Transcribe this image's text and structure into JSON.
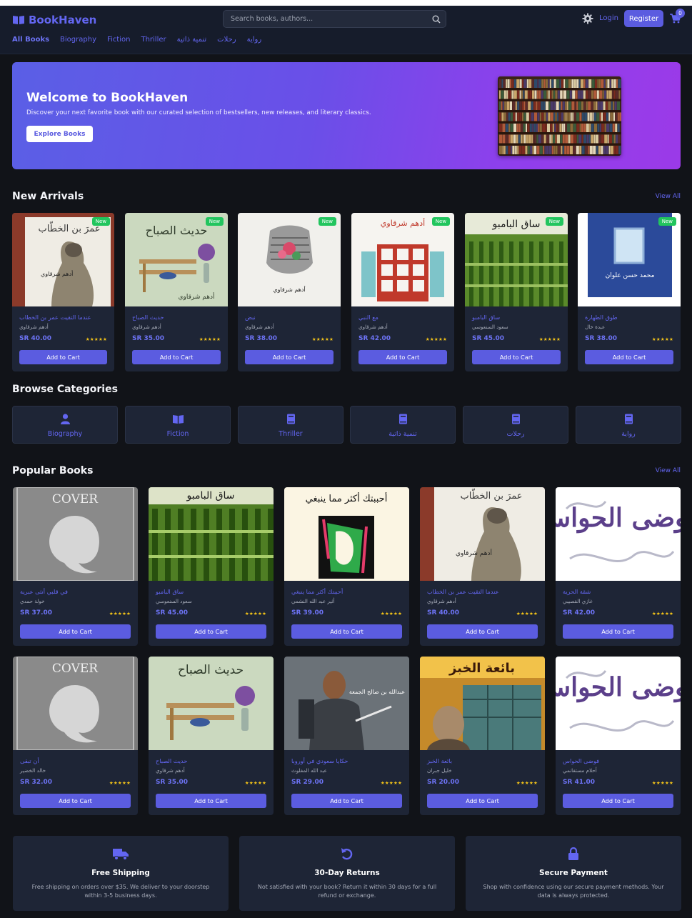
{
  "brand": {
    "name": "BookHaven",
    "accent": "#6366f1"
  },
  "header": {
    "search_placeholder": "Search books, authors...",
    "login": "Login",
    "register": "Register",
    "cart_count": "0"
  },
  "nav": [
    "All Books",
    "Biography",
    "Fiction",
    "Thriller",
    "تنمية ذاتية",
    "رحلات",
    "رواية"
  ],
  "hero": {
    "title": "Welcome to BookHaven",
    "subtitle": "Discover your next favorite book with our curated selection of bestsellers, new releases, and literary classics.",
    "button": "Explore Books"
  },
  "new_arrivals": {
    "title": "New Arrivals",
    "view_all": "View All",
    "badge": "New",
    "add_label": "Add to Cart",
    "stars": "★★★★★",
    "books": [
      {
        "title": "عندما التقيت عمر بن الخطاب",
        "author": "أدهم شرقاوي",
        "price": "SR 40.00"
      },
      {
        "title": "حديث الصباح",
        "author": "أدهم شرقاوي",
        "price": "SR 35.00"
      },
      {
        "title": "نبض",
        "author": "أدهم شرقاوي",
        "price": "SR 38.00"
      },
      {
        "title": "مع النبي",
        "author": "أدهم شرقاوي",
        "price": "SR 42.00"
      },
      {
        "title": "ساق البامبو",
        "author": "سعود السنعوسي",
        "price": "SR 45.00"
      },
      {
        "title": "طوق الطهارة",
        "author": "عبدة خال",
        "price": "SR 38.00"
      }
    ],
    "cover_text": {
      "c0": "عمرَ بن الخطّاب",
      "c0b": "أدهم شرقاوي",
      "c1": "حديث الصباح",
      "c1b": "أدهم شرقاوي",
      "c2": "أدهم شرقاوي",
      "c3": "أدهم شرقاوي",
      "c4": "ساق البامبو",
      "c5": "محمد حسن علوان"
    }
  },
  "categories": {
    "title": "Browse Categories",
    "items": [
      "Biography",
      "Fiction",
      "Thriller",
      "تنمية ذاتية",
      "رحلات",
      "رواية"
    ]
  },
  "popular": {
    "title": "Popular Books",
    "view_all": "View All",
    "add_label": "Add to Cart",
    "stars": "★★★★★",
    "books": [
      {
        "title": "في قلبي أنثى عبرية",
        "author": "خولة حمدي",
        "price": "SR 37.00"
      },
      {
        "title": "ساق البامبو",
        "author": "سعود السنعوسي",
        "price": "SR 45.00"
      },
      {
        "title": "أحببتك أكثر مما ينبغي",
        "author": "أثير عبد الله النشمي",
        "price": "SR 39.00"
      },
      {
        "title": "عندما التقيت عمر بن الخطاب",
        "author": "أدهم شرقاوي",
        "price": "SR 40.00"
      },
      {
        "title": "شقة الحرية",
        "author": "غازي القصيبي",
        "price": "SR 42.00"
      },
      {
        "title": "أن تبقى",
        "author": "خالد الخضير",
        "price": "SR 32.00"
      },
      {
        "title": "حديث الصباح",
        "author": "أدهم شرقاوي",
        "price": "SR 35.00"
      },
      {
        "title": "حكايا سعودي في أوروبا",
        "author": "عبد الله المغلوث",
        "price": "SR 29.00"
      },
      {
        "title": "بائعة الخبز",
        "author": "خليل جبران",
        "price": "SR 20.00"
      },
      {
        "title": "فوضى الحواس",
        "author": "أحلام مستغانمي",
        "price": "SR 41.00"
      }
    ],
    "cover_text": {
      "nocover": "COVER",
      "saq": "ساق البامبو",
      "ahbabtuk": "أحببتك أكثر مما ينبغي",
      "omar": "عمرَ بن الخطّاب",
      "omar_b": "أدهم شرقاوي",
      "fawda": "فوضى الحواس",
      "hadith": "حديث الصباح",
      "abdullah": "عبدالله بن صالح الجمعة",
      "baea": "بائعة الخبز"
    }
  },
  "features": [
    {
      "title": "Free Shipping",
      "text": "Free shipping on orders over $35. We deliver to your doorstep within 3-5 business days.",
      "icon": "truck-icon"
    },
    {
      "title": "30-Day Returns",
      "text": "Not satisfied with your book? Return it within 30 days for a full refund or exchange.",
      "icon": "undo-icon"
    },
    {
      "title": "Secure Payment",
      "text": "Shop with confidence using our secure payment methods. Your data is always protected.",
      "icon": "lock-icon"
    }
  ]
}
